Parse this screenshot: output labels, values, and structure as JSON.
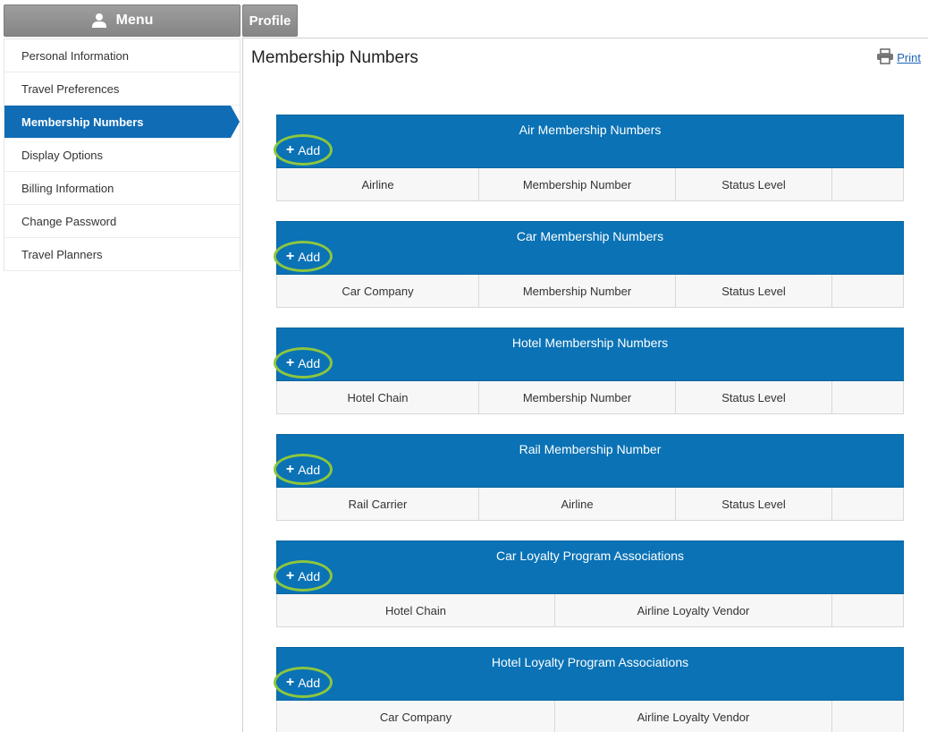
{
  "sidebar": {
    "menu_label": "Menu",
    "items": [
      {
        "label": "Personal Information",
        "active": false
      },
      {
        "label": "Travel Preferences",
        "active": false
      },
      {
        "label": "Membership Numbers",
        "active": true
      },
      {
        "label": "Display Options",
        "active": false
      },
      {
        "label": "Billing Information",
        "active": false
      },
      {
        "label": "Change Password",
        "active": false
      },
      {
        "label": "Travel Planners",
        "active": false
      }
    ]
  },
  "tabs": {
    "profile_label": "Profile"
  },
  "main": {
    "title": "Membership Numbers",
    "print_label": "Print",
    "add_label": "Add",
    "sections": [
      {
        "title": "Air Membership Numbers",
        "columns": [
          "Airline",
          "Membership Number",
          "Status Level",
          ""
        ]
      },
      {
        "title": "Car Membership Numbers",
        "columns": [
          "Car Company",
          "Membership Number",
          "Status Level",
          ""
        ]
      },
      {
        "title": "Hotel Membership Numbers",
        "columns": [
          "Hotel Chain",
          "Membership Number",
          "Status Level",
          ""
        ]
      },
      {
        "title": "Rail Membership Number",
        "columns": [
          "Rail Carrier",
          "Airline",
          "Status Level",
          ""
        ]
      },
      {
        "title": "Car Loyalty Program Associations",
        "columns": [
          "Hotel Chain",
          "Airline Loyalty Vendor",
          ""
        ]
      },
      {
        "title": "Hotel Loyalty Program Associations",
        "columns": [
          "Car Company",
          "Airline Loyalty Vendor",
          ""
        ]
      }
    ]
  },
  "colors": {
    "accent_blue": "#0a72b5",
    "active_nav": "#0f6cb5",
    "add_highlight": "#8cc63f",
    "link": "#1f62b8"
  }
}
